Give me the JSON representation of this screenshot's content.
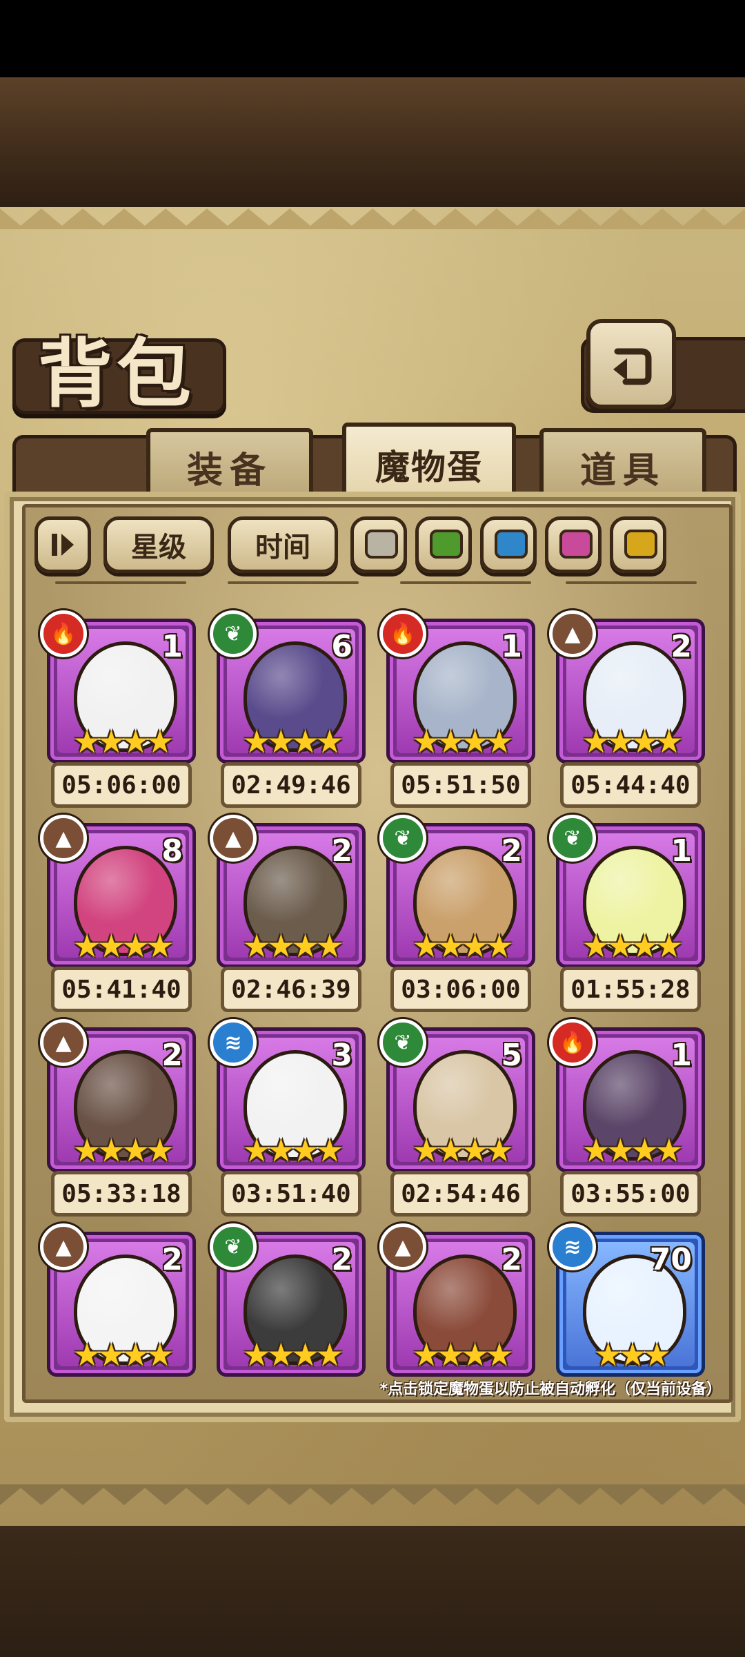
{
  "header": {
    "title": "背包"
  },
  "tabs": [
    {
      "label": "装备",
      "active": false
    },
    {
      "label": "魔物蛋",
      "active": true
    },
    {
      "label": "道具",
      "active": false
    }
  ],
  "filters": {
    "sort_star_label": "星级",
    "sort_time_label": "时间",
    "color_swatches": [
      "#b8b3a3",
      "#4f9a2c",
      "#2f86c9",
      "#c94a9a",
      "#d6a71b"
    ]
  },
  "eggs": [
    {
      "count": "1",
      "stars": "★★★★",
      "timer": "05:06:00",
      "element": "fire",
      "color": "#f1f1f1"
    },
    {
      "count": "6",
      "stars": "★★★★",
      "timer": "02:49:46",
      "element": "leaf",
      "color": "#5a4b8c"
    },
    {
      "count": "1",
      "stars": "★★★★",
      "timer": "05:51:50",
      "element": "fire",
      "color": "#a7b4c9"
    },
    {
      "count": "2",
      "stars": "★★★★",
      "timer": "05:44:40",
      "element": "earth",
      "color": "#e7eef7"
    },
    {
      "count": "8",
      "stars": "★★★★",
      "timer": "05:41:40",
      "element": "earth",
      "color": "#d2447f"
    },
    {
      "count": "2",
      "stars": "★★★★",
      "timer": "02:46:39",
      "element": "earth",
      "color": "#6b5c4c"
    },
    {
      "count": "2",
      "stars": "★★★★",
      "timer": "03:06:00",
      "element": "leaf",
      "color": "#caa06b"
    },
    {
      "count": "1",
      "stars": "★★★★",
      "timer": "01:55:28",
      "element": "leaf",
      "color": "#eef3a4"
    },
    {
      "count": "2",
      "stars": "★★★★",
      "timer": "05:33:18",
      "element": "earth",
      "color": "#6a5246"
    },
    {
      "count": "3",
      "stars": "★★★★",
      "timer": "03:51:40",
      "element": "water",
      "color": "#f2f2f2"
    },
    {
      "count": "5",
      "stars": "★★★★",
      "timer": "02:54:46",
      "element": "leaf",
      "color": "#d9c6a6"
    },
    {
      "count": "1",
      "stars": "★★★★",
      "timer": "03:55:00",
      "element": "fire",
      "color": "#5b4568"
    },
    {
      "count": "2",
      "stars": "★★★★",
      "timer": "",
      "element": "earth",
      "color": "#f4f4f4"
    },
    {
      "count": "2",
      "stars": "★★★★",
      "timer": "",
      "element": "leaf",
      "color": "#3c3c3c"
    },
    {
      "count": "2",
      "stars": "★★★★",
      "timer": "",
      "element": "earth",
      "color": "#8b4b3a"
    },
    {
      "count": "70",
      "stars": "★★★",
      "timer": "",
      "element": "water",
      "color": "#e8f3ff",
      "frame": "blue"
    }
  ],
  "hint": "*点击锁定魔物蛋以防止被自动孵化（仅当前设备）"
}
